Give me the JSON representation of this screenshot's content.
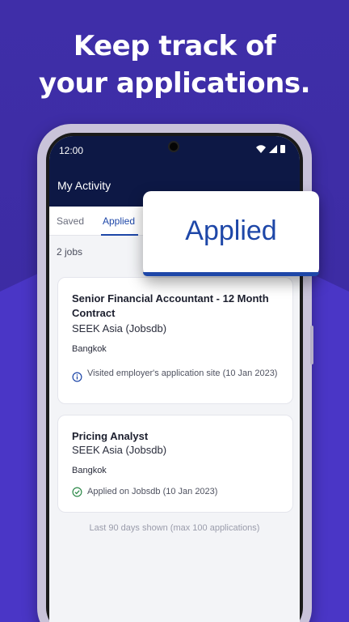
{
  "promo": {
    "headline_line1": "Keep track of",
    "headline_line2": "your applications."
  },
  "status_bar": {
    "time": "12:00",
    "icons": [
      "wifi-icon",
      "signal-icon",
      "battery-icon"
    ]
  },
  "app": {
    "title": "My Activity"
  },
  "tabs": [
    {
      "label": "Saved",
      "selected": false
    },
    {
      "label": "Applied",
      "selected": true
    }
  ],
  "job_count": "2 jobs",
  "jobs": [
    {
      "title": "Senior Financial Accountant - 12 Month Contract",
      "company": "SEEK Asia (Jobsdb)",
      "location": "Bangkok",
      "status_text": "Visited employer's application site (10 Jan 2023)",
      "status_icon": "info-icon"
    },
    {
      "title": "Pricing Analyst",
      "company": "SEEK Asia (Jobsdb)",
      "location": "Bangkok",
      "status_text": "Applied on Jobsdb (10 Jan 2023)",
      "status_icon": "check-circle-icon"
    }
  ],
  "footer_note": "Last 90 days shown (max 100 applications)",
  "callout": {
    "label": "Applied"
  },
  "colors": {
    "brand_purple": "#3f2ea8",
    "app_bar": "#0d1845",
    "accent_blue": "#1e47a8",
    "success_green": "#2e8a4a"
  }
}
